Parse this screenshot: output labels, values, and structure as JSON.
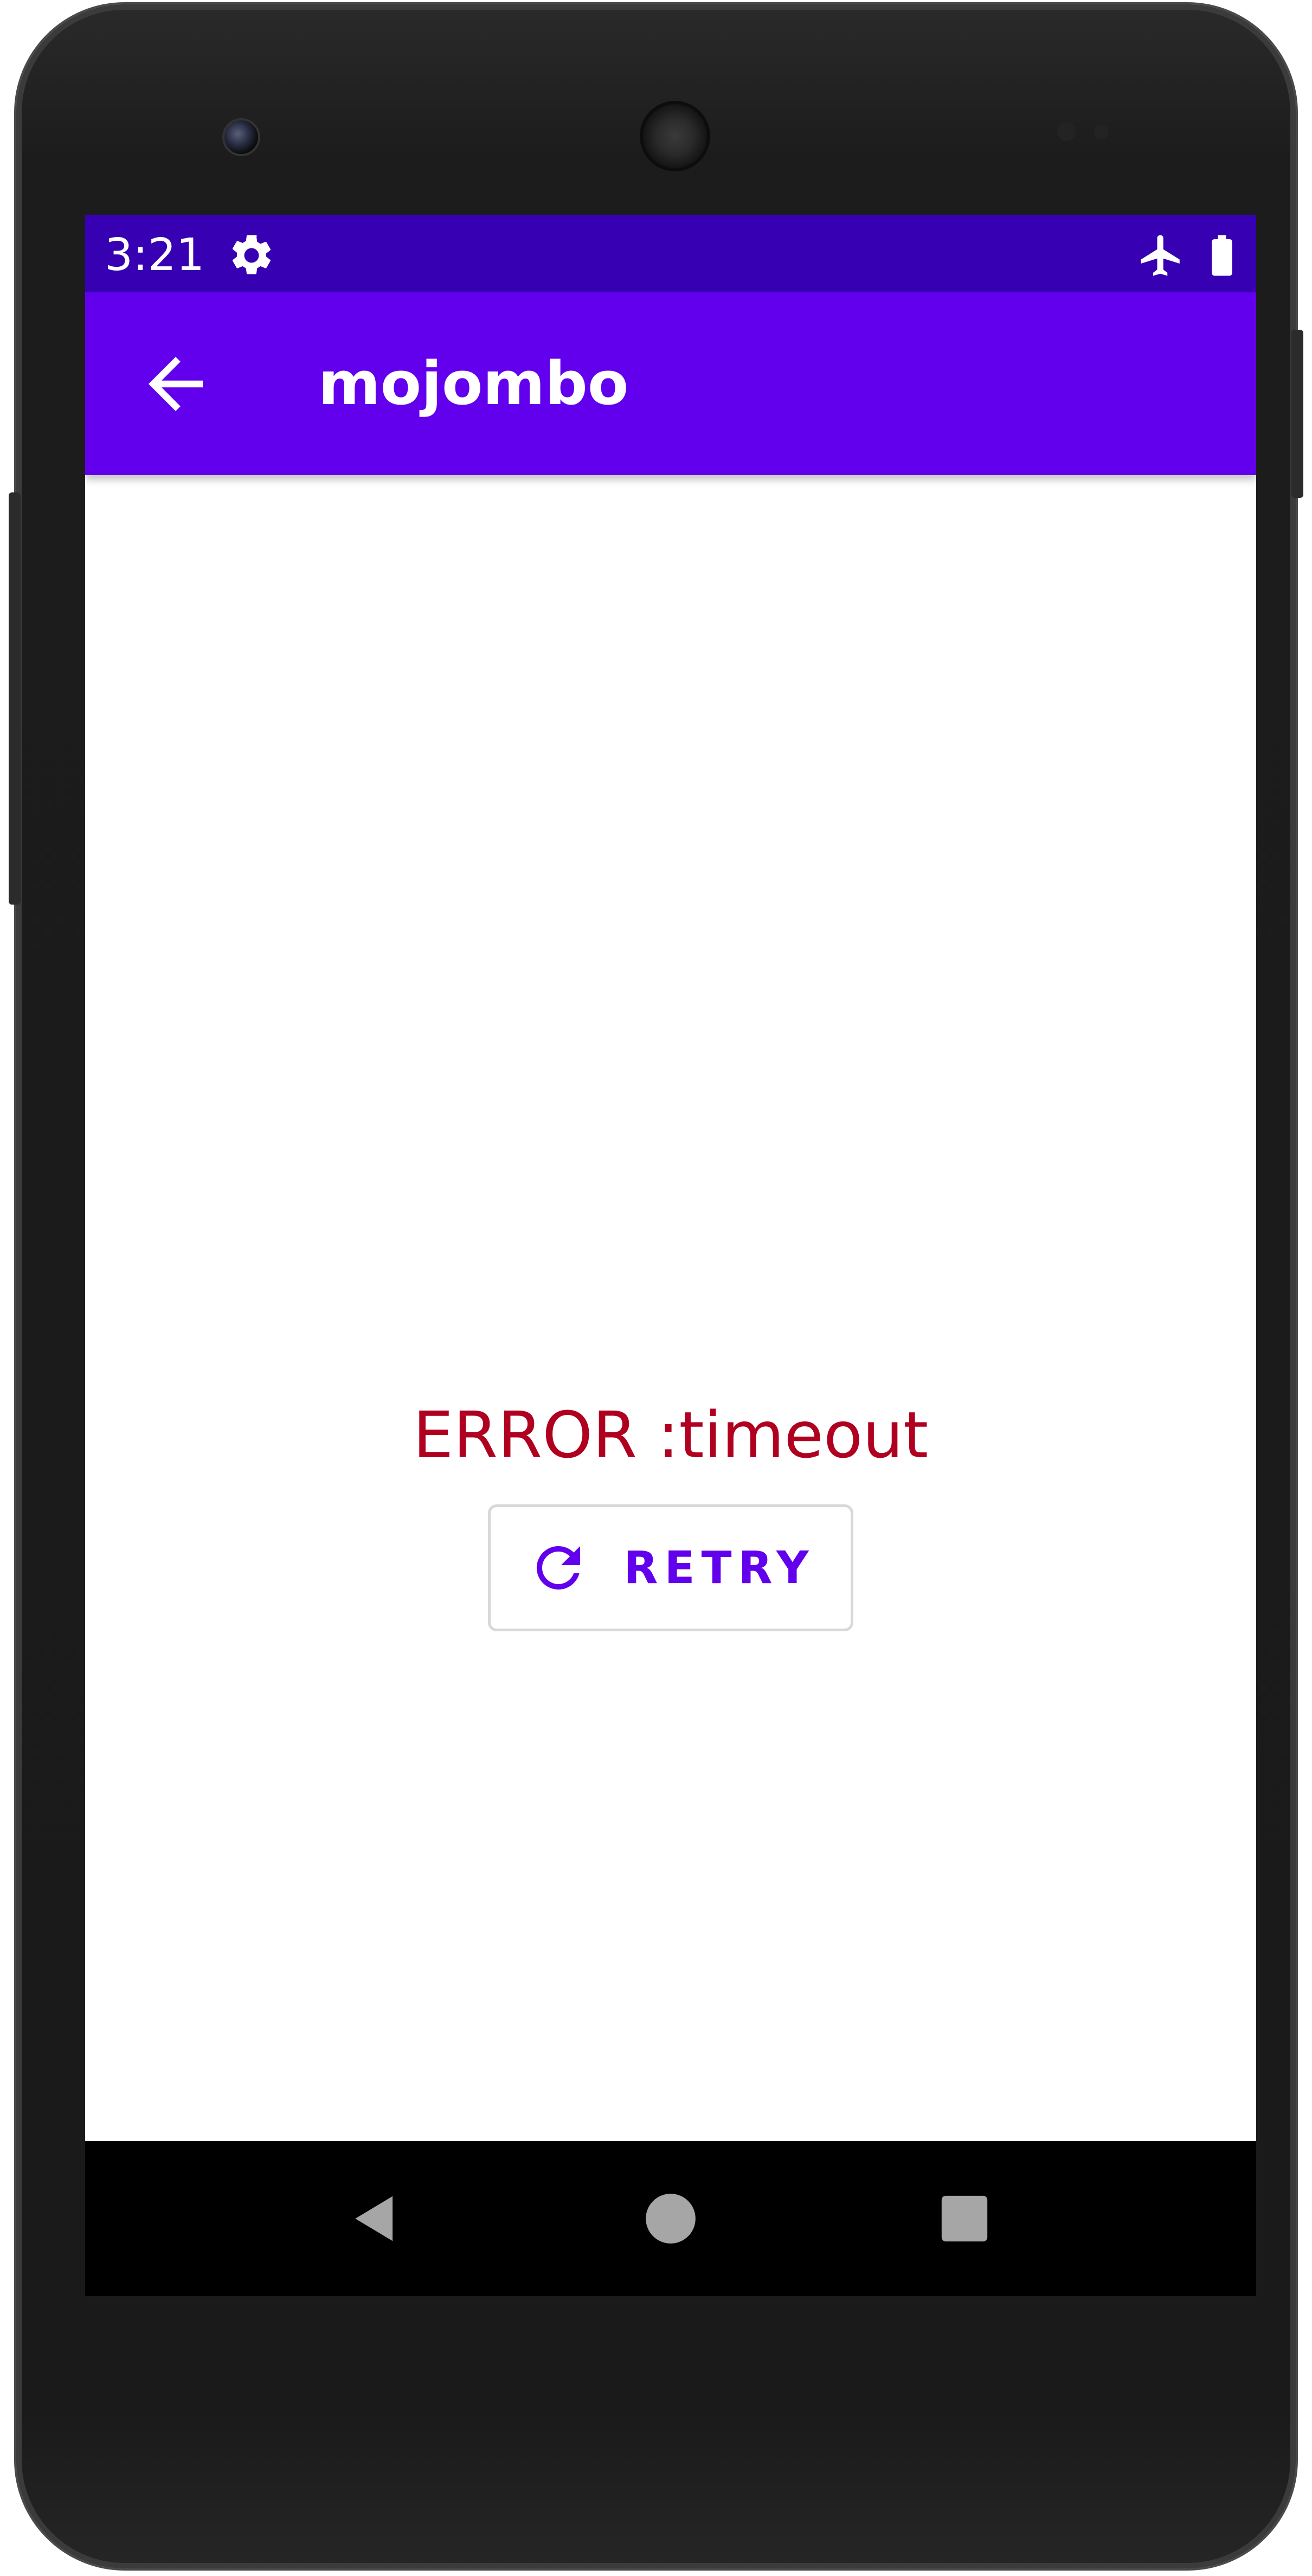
{
  "status_bar": {
    "time": "3:21",
    "icons": [
      "settings-gear-icon",
      "airplane-mode-icon",
      "battery-full-icon"
    ],
    "background_color": "#3700b3"
  },
  "app_bar": {
    "title": "mojombo",
    "back_icon": "arrow-back-icon",
    "background_color": "#6200ee"
  },
  "error": {
    "message": "ERROR :timeout",
    "color": "#b00020"
  },
  "retry_button": {
    "label": "RETRY",
    "icon": "refresh-icon",
    "color": "#6200ee"
  },
  "nav_bar": {
    "buttons": [
      "back-triangle-icon",
      "home-circle-icon",
      "recents-square-icon"
    ]
  }
}
